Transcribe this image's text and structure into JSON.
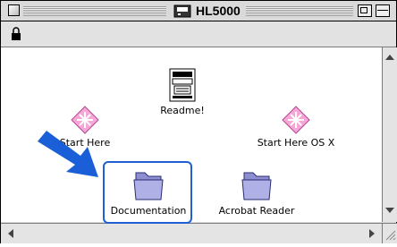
{
  "window": {
    "title": "HL5000"
  },
  "items": [
    {
      "label": "Readme!"
    },
    {
      "label": "Start Here"
    },
    {
      "label": "Start Here OS X"
    },
    {
      "label": "Documentation"
    },
    {
      "label": "Acrobat Reader"
    }
  ],
  "colors": {
    "highlight": "#1f5fd3",
    "pointer_arrow": "#1b5fd8",
    "folder": "#9d9fd8"
  }
}
